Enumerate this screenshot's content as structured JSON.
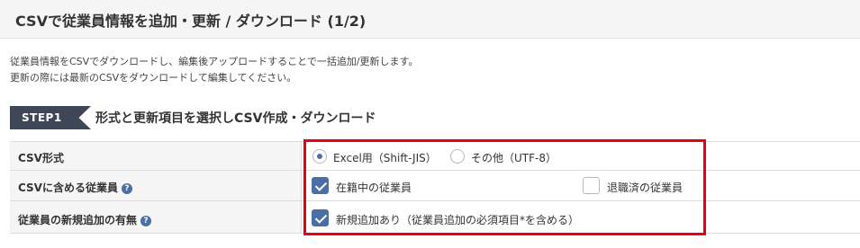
{
  "header": {
    "title": "CSVで従業員情報を追加・更新 / ダウンロード (1/2)"
  },
  "description": {
    "line1": "従業員情報をCSVでダウンロードし、編集後アップロードすることで一括追加/更新します。",
    "line2": "更新の際には最新のCSVをダウンロードして編集してください。"
  },
  "step": {
    "badge": "STEP1",
    "title": "形式と更新項目を選択しCSV作成・ダウンロード"
  },
  "form": {
    "csv_format": {
      "label": "CSV形式",
      "options": [
        {
          "label": "Excel用（Shift-JIS）",
          "selected": true
        },
        {
          "label": "その他（UTF-8）",
          "selected": false
        }
      ]
    },
    "employees_included": {
      "label": "CSVに含める従業員",
      "help_icon": "?",
      "options": [
        {
          "label": "在籍中の従業員",
          "checked": true
        },
        {
          "label": "退職済の従業員",
          "checked": false
        }
      ]
    },
    "new_addition": {
      "label": "従業員の新規追加の有無",
      "help_icon": "?",
      "options": [
        {
          "label": "新規追加あり（従業員追加の必須項目*を含める）",
          "checked": true
        }
      ]
    }
  },
  "colors": {
    "accent": "#4a6fa5",
    "badge": "#3d4758",
    "highlight": "#e60012",
    "label_bg": "#f5f5f5"
  }
}
